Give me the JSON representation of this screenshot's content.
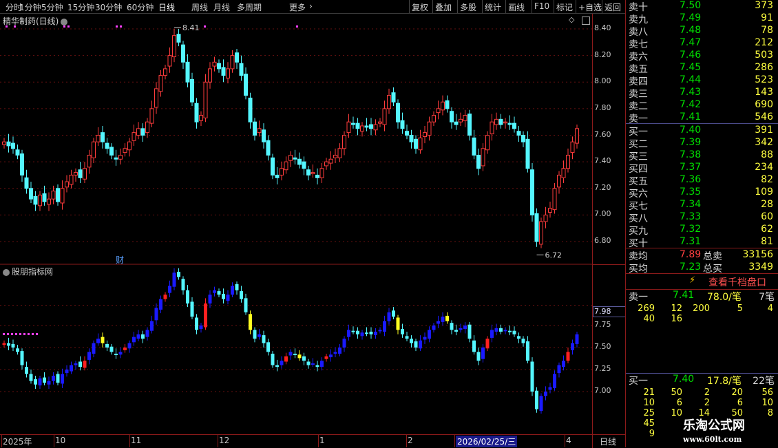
{
  "toolbar": {
    "left_items": [
      "分时",
      "1分钟",
      "5分钟",
      "15分钟",
      "30分钟",
      "60分钟",
      "日线",
      "周线",
      "月线",
      "多周期",
      "更多"
    ],
    "active": "日线",
    "right_items": [
      "复权",
      "叠加",
      "多股",
      "统计",
      "画线",
      "F10",
      "标记",
      "+自选",
      "返回"
    ]
  },
  "main_chart": {
    "title": "精华制药(日线)",
    "high_label": "8.41",
    "low_label": "6.72",
    "marker_cai": "财",
    "y_ticks": [
      "8.40",
      "8.20",
      "8.00",
      "7.80",
      "7.60",
      "7.40",
      "7.20",
      "7.00",
      "6.80"
    ]
  },
  "sub_chart": {
    "title": "股朋指标网",
    "price_tag": "7.98",
    "y_ticks": [
      "7.75",
      "7.50",
      "7.25",
      "7.00"
    ]
  },
  "date_axis": {
    "labels": [
      "2025年",
      "10",
      "11",
      "12",
      "1",
      "2",
      "2026/02/25/三",
      "4"
    ],
    "period": "日线"
  },
  "chart_data": {
    "type": "candlestick",
    "title": "精华制药(日线)",
    "ylim": [
      6.7,
      8.45
    ],
    "high": 8.41,
    "low": 6.72,
    "closes": [
      7.55,
      7.52,
      7.5,
      7.45,
      7.3,
      7.2,
      7.12,
      7.08,
      7.15,
      7.1,
      7.12,
      7.18,
      7.1,
      7.2,
      7.25,
      7.3,
      7.32,
      7.28,
      7.35,
      7.45,
      7.55,
      7.6,
      7.55,
      7.5,
      7.45,
      7.42,
      7.45,
      7.5,
      7.55,
      7.62,
      7.65,
      7.6,
      7.7,
      7.8,
      7.95,
      8.05,
      8.1,
      8.2,
      8.35,
      8.3,
      8.15,
      8.0,
      7.85,
      7.7,
      7.75,
      8.0,
      8.1,
      8.15,
      8.1,
      8.05,
      8.1,
      8.2,
      8.15,
      8.05,
      7.9,
      7.7,
      7.6,
      7.65,
      7.55,
      7.45,
      7.3,
      7.28,
      7.35,
      7.4,
      7.45,
      7.42,
      7.38,
      7.35,
      7.3,
      7.32,
      7.28,
      7.35,
      7.4,
      7.42,
      7.45,
      7.5,
      7.6,
      7.7,
      7.68,
      7.65,
      7.67,
      7.66,
      7.65,
      7.68,
      7.7,
      7.8,
      7.9,
      7.85,
      7.7,
      7.65,
      7.6,
      7.55,
      7.5,
      7.58,
      7.62,
      7.7,
      7.75,
      7.8,
      7.85,
      7.8,
      7.7,
      7.68,
      7.72,
      7.75,
      7.6,
      7.45,
      7.35,
      7.5,
      7.6,
      7.7,
      7.72,
      7.68,
      7.7,
      7.68,
      7.65,
      7.6,
      7.55,
      7.35,
      7.0,
      6.8,
      6.95,
      7.0,
      7.05,
      7.2,
      7.3,
      7.35,
      7.45,
      7.55,
      7.65
    ]
  },
  "order_book": {
    "asks": [
      {
        "label": "卖十",
        "price": "7.50",
        "vol": "373"
      },
      {
        "label": "卖九",
        "price": "7.49",
        "vol": "91"
      },
      {
        "label": "卖八",
        "price": "7.48",
        "vol": "78"
      },
      {
        "label": "卖七",
        "price": "7.47",
        "vol": "212"
      },
      {
        "label": "卖六",
        "price": "7.46",
        "vol": "503"
      },
      {
        "label": "卖五",
        "price": "7.45",
        "vol": "286"
      },
      {
        "label": "卖四",
        "price": "7.44",
        "vol": "523"
      },
      {
        "label": "卖三",
        "price": "7.43",
        "vol": "143"
      },
      {
        "label": "卖二",
        "price": "7.42",
        "vol": "690"
      },
      {
        "label": "卖一",
        "price": "7.41",
        "vol": "546"
      }
    ],
    "bids": [
      {
        "label": "买一",
        "price": "7.40",
        "vol": "391"
      },
      {
        "label": "买二",
        "price": "7.39",
        "vol": "342"
      },
      {
        "label": "买三",
        "price": "7.38",
        "vol": "88"
      },
      {
        "label": "买四",
        "price": "7.37",
        "vol": "234"
      },
      {
        "label": "买五",
        "price": "7.36",
        "vol": "82"
      },
      {
        "label": "买六",
        "price": "7.35",
        "vol": "109"
      },
      {
        "label": "买七",
        "price": "7.34",
        "vol": "28"
      },
      {
        "label": "买八",
        "price": "7.33",
        "vol": "60"
      },
      {
        "label": "买九",
        "price": "7.32",
        "vol": "62"
      },
      {
        "label": "买十",
        "price": "7.31",
        "vol": "81"
      }
    ],
    "avg_sell_label": "卖均",
    "avg_sell": "7.89",
    "total_sell_label": "总卖",
    "total_sell": "33156",
    "avg_buy_label": "买均",
    "avg_buy": "7.23",
    "total_buy_label": "总买",
    "total_buy": "3349",
    "view_thousand": "查看千档盘口",
    "sell1": {
      "label": "卖一",
      "price": "7.41",
      "avg": "78.0/笔",
      "count": "7笔",
      "rows": [
        [
          "269",
          "12",
          "200",
          "5",
          "4"
        ],
        [
          "40",
          "16",
          "",
          "",
          ""
        ]
      ]
    },
    "buy1": {
      "label": "买一",
      "price": "7.40",
      "avg": "17.8/笔",
      "count": "22笔",
      "rows": [
        [
          "21",
          "50",
          "2",
          "20",
          "56"
        ],
        [
          "10",
          "6",
          "2",
          "6",
          "10"
        ],
        [
          "25",
          "10",
          "14",
          "50",
          "8"
        ],
        [
          "45",
          "",
          "",
          "",
          ""
        ],
        [
          "9",
          "",
          "",
          "",
          ""
        ]
      ]
    }
  },
  "watermark": {
    "name": "乐淘公式网",
    "url": "www.60lt.com"
  }
}
